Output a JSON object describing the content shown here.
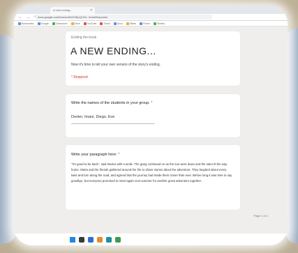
{
  "browser": {
    "tab_title": "A new ending...",
    "url": "docs.google.com/forms/d/e/1FAIpQLSd.../formResponse",
    "bookmarks": [
      {
        "label": "Bookmarks",
        "color": "#6b8fd6"
      },
      {
        "label": "Google",
        "color": "#6b8fd6"
      },
      {
        "label": "Classroom",
        "color": "#4caf50"
      },
      {
        "label": "Drive",
        "color": "#e0b04a"
      },
      {
        "label": "YouTube",
        "color": "#d9534f"
      },
      {
        "label": "Gmail",
        "color": "#d9534f"
      },
      {
        "label": "Docs",
        "color": "#6b8fd6"
      },
      {
        "label": "Slides",
        "color": "#e0b04a"
      },
      {
        "label": "Forms",
        "color": "#6b8fd6"
      },
      {
        "label": "Sheets",
        "color": "#4caf50"
      }
    ]
  },
  "form": {
    "section_label": "Ending the book",
    "title": "A NEW ENDING...",
    "description": "Now it's time to tell your own version of the story's ending.",
    "required_note": "* Required",
    "question_names": "Write the names of the students in your group.",
    "answer_names": "Dexter, Imani, Diego, Eve",
    "question_paragraph": "Write your paragraph here:",
    "answer_paragraph": "\"It's good to be back\", said Dexter with a smile. The gang continued on as the sun went down and the stars lit the way home. Maria and the friends gathered around the fire to share stories about the adventure. They laughed about every twist and turn along the road, and agreed that the journey had made them closer than ever. Before long it was time to say goodbye, but everyone promised to meet again next summer for another great adventure together.",
    "page_counter": "Page 1 of 1"
  }
}
